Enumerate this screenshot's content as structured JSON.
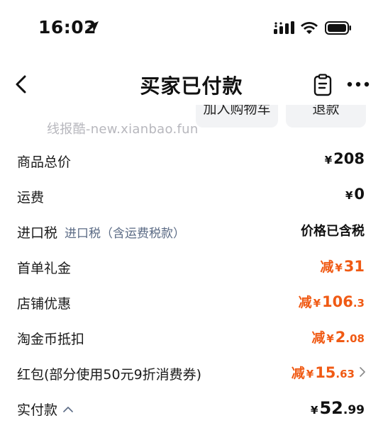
{
  "status_bar": {
    "time": "16:02"
  },
  "nav": {
    "title": "买家已付款"
  },
  "actions": {
    "cart_label": "加入购物车",
    "refund_label": "退款"
  },
  "watermark": "线报酷-new.xianbao.fun",
  "price_rows": [
    {
      "label": "商品总价",
      "currency": "¥",
      "amount": "208"
    },
    {
      "label": "运费",
      "currency": "¥",
      "amount": "0"
    },
    {
      "label": "进口税",
      "sublabel": "进口税（含运费税款）",
      "value_text": "价格已含税"
    },
    {
      "label": "首单礼金",
      "prefix": "减",
      "currency": "¥",
      "amount": "31"
    },
    {
      "label": "店铺优惠",
      "prefix": "减",
      "currency": "¥",
      "amount_int": "106",
      "amount_dec": ".3"
    },
    {
      "label": "淘金币抵扣",
      "prefix": "减",
      "currency": "¥",
      "amount_int": "2",
      "amount_dec": ".08"
    },
    {
      "label": "红包(部分使用50元9折消费券)",
      "prefix": "减",
      "currency": "¥",
      "amount_int": "15",
      "amount_dec": ".63"
    },
    {
      "label": "实付款",
      "currency": "¥",
      "amount_int": "52",
      "amount_dec": ".99"
    }
  ],
  "colors": {
    "accent": "#f05a14",
    "sublabel": "#5b6b85",
    "button_bg": "#f2f3f5"
  }
}
